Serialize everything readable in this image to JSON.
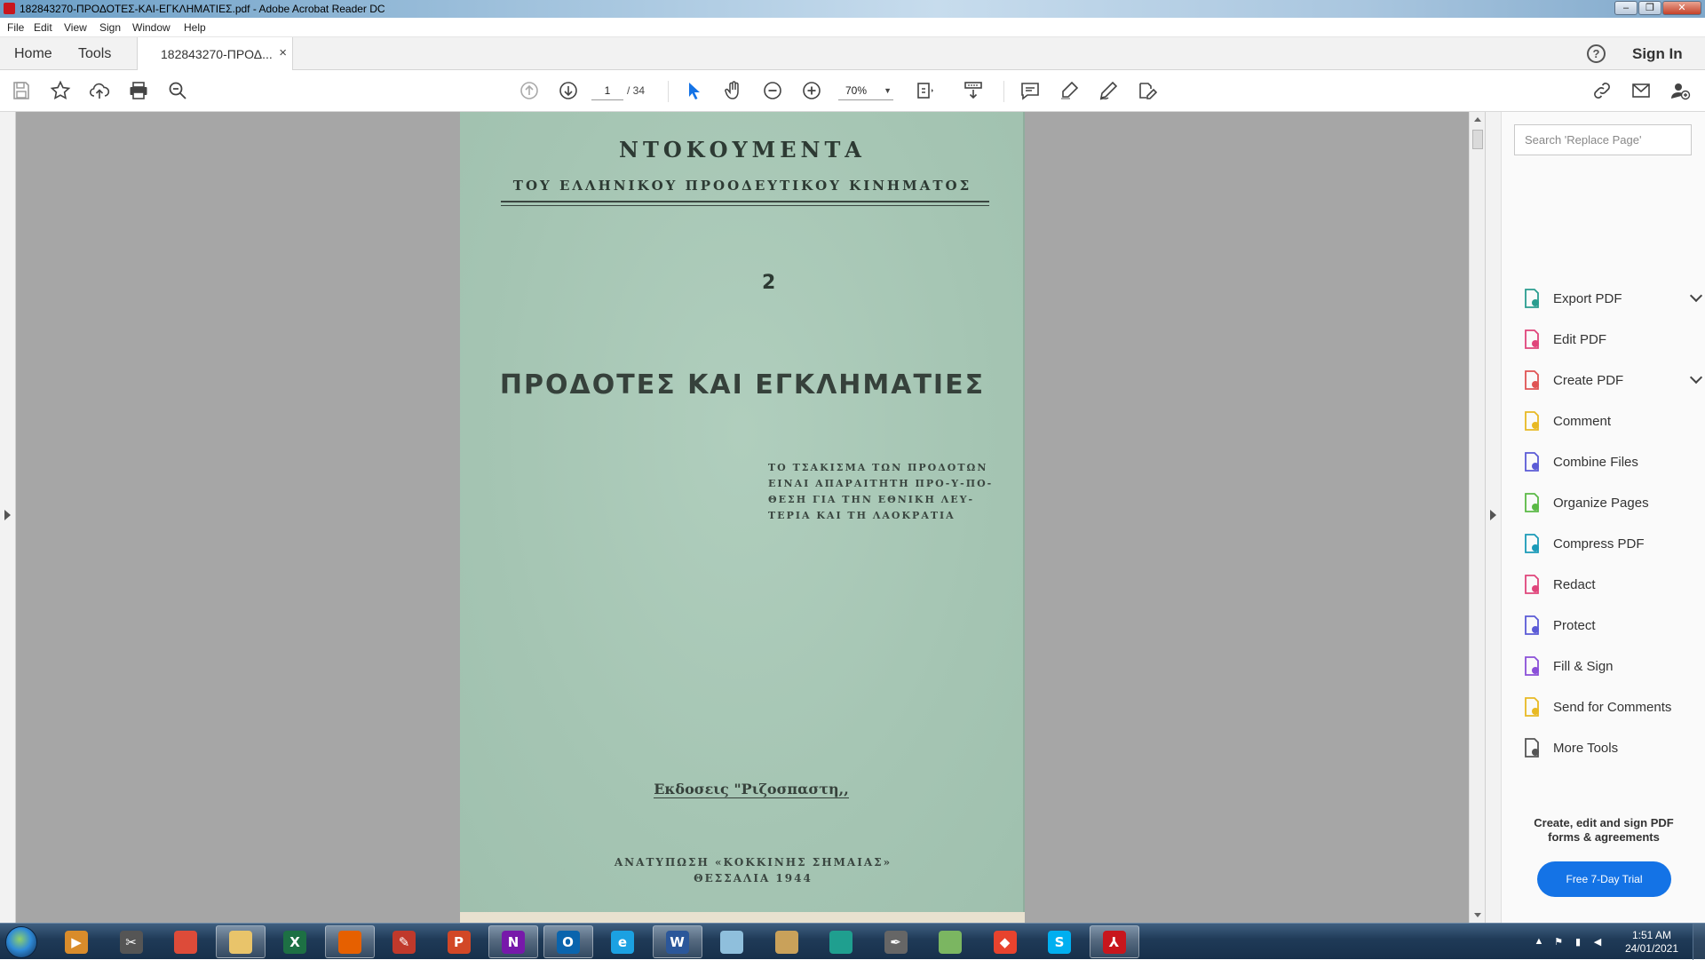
{
  "window": {
    "title": "182843270-ΠΡΟΔΟΤΕΣ-ΚΑΙ-ΕΓΚΛΗΜΑΤΙΕΣ.pdf - Adobe Acrobat Reader DC"
  },
  "menu": [
    "File",
    "Edit",
    "View",
    "Sign",
    "Window",
    "Help"
  ],
  "tabs": {
    "home": "Home",
    "tools": "Tools",
    "document": "182843270-ΠΡΟΔ...",
    "close": "×"
  },
  "header": {
    "help": "?",
    "sign_in": "Sign In"
  },
  "toolbar": {
    "current_page": "1",
    "total_pages": "/ 34",
    "zoom": "70%",
    "icons": [
      "save-icon",
      "bookmark-star-icon",
      "upload-cloud-icon",
      "print-icon",
      "search-zoom-icon",
      "prev-page-icon",
      "next-page-icon",
      "select-cursor-icon",
      "hand-icon",
      "zoom-out-icon",
      "zoom-in-icon",
      "page-fit-icon",
      "scroll-mode-icon",
      "comment-icon",
      "highlight-icon",
      "sign-icon",
      "share-edit-icon",
      "link-icon",
      "email-icon",
      "add-user-icon"
    ]
  },
  "page": {
    "heading": "ΝΤΟΚΟΥΜΕΝΤΑ",
    "subheading": "ΤΟΥ ΕΛΛΗΝΙΚΟΥ ΠΡΟΟΔΕΥΤΙΚΟΥ ΚΙΝΗΜΑΤΟΣ",
    "number": "2",
    "title": "ΠΡΟΔΟΤΕΣ ΚΑΙ ΕΓΚΛΗΜΑΤΙΕΣ",
    "quote": "ΤΟ ΤΣΑΚΙΣΜΑ ΤΩΝ ΠΡΟΔΟΤΩΝ\nΕΙΝΑΙ ΑΠΑΡΑΙΤΗΤΗ ΠΡΟ-Υ-ΠΟ-\nΘΕΣΗ ΓΙΑ ΤΗΝ ΕΘΝΙΚΗ ΛΕΥ-\nΤΕΡΙΑ ΚΑΙ ΤΗ ΛΑΟΚΡΑΤΙΑ",
    "publisher": "Εκδοσεις \"Ριζοσπαστη,,",
    "footer_line1": "ΑΝΑΤΥΠΩΣΗ «ΚΟΚΚΙΝΗΣ ΣΗΜΑΙΑΣ»",
    "footer_line2": "ΘΕΣΣΑΛΙΑ 1944"
  },
  "right_panel": {
    "search_placeholder": "Search 'Replace Page'",
    "tools": [
      {
        "label": "Export PDF",
        "icon": "export-pdf-icon",
        "color": "#2a9d8f",
        "expand": true
      },
      {
        "label": "Edit PDF",
        "icon": "edit-pdf-icon",
        "color": "#e0457b",
        "expand": false
      },
      {
        "label": "Create PDF",
        "icon": "create-pdf-icon",
        "color": "#e05454",
        "expand": true
      },
      {
        "label": "Comment",
        "icon": "comment-icon",
        "color": "#e8b923",
        "expand": false
      },
      {
        "label": "Combine Files",
        "icon": "combine-files-icon",
        "color": "#5b5bd6",
        "expand": false
      },
      {
        "label": "Organize Pages",
        "icon": "organize-pages-icon",
        "color": "#5ab945",
        "expand": false
      },
      {
        "label": "Compress PDF",
        "icon": "compress-pdf-icon",
        "color": "#1a9ab8",
        "expand": false
      },
      {
        "label": "Redact",
        "icon": "redact-icon",
        "color": "#e0457b",
        "expand": false
      },
      {
        "label": "Protect",
        "icon": "protect-shield-icon",
        "color": "#5b5bd6",
        "expand": false
      },
      {
        "label": "Fill & Sign",
        "icon": "fill-sign-icon",
        "color": "#8a4fd8",
        "expand": false
      },
      {
        "label": "Send for Comments",
        "icon": "send-comments-icon",
        "color": "#e8b923",
        "expand": false
      },
      {
        "label": "More Tools",
        "icon": "more-tools-icon",
        "color": "#555555",
        "expand": false
      }
    ],
    "promo": "Create, edit and sign PDF\nforms & agreements",
    "trial_button": "Free 7-Day Trial"
  },
  "taskbar": {
    "apps": [
      {
        "name": "media-player-icon",
        "letter": "▶",
        "color": "#d98c2b"
      },
      {
        "name": "snipping-tool-icon",
        "letter": "✂",
        "color": "#555"
      },
      {
        "name": "chrome-icon",
        "letter": "",
        "color": "#dd4b39"
      },
      {
        "name": "file-explorer-icon",
        "letter": "",
        "color": "#e9c46a"
      },
      {
        "name": "excel-icon",
        "letter": "X",
        "color": "#1d7044"
      },
      {
        "name": "firefox-icon",
        "letter": "",
        "color": "#e66000"
      },
      {
        "name": "paint-brush-icon",
        "letter": "✎",
        "color": "#c0392b"
      },
      {
        "name": "powerpoint-icon",
        "letter": "P",
        "color": "#d24726"
      },
      {
        "name": "onenote-icon",
        "letter": "N",
        "color": "#7719aa"
      },
      {
        "name": "outlook-icon",
        "letter": "O",
        "color": "#0a64ad"
      },
      {
        "name": "internet-explorer-icon",
        "letter": "e",
        "color": "#1ba1e2"
      },
      {
        "name": "word-icon",
        "letter": "W",
        "color": "#2b579a"
      },
      {
        "name": "notepad-icon",
        "letter": "",
        "color": "#8fbfdc"
      },
      {
        "name": "paint-icon",
        "letter": "",
        "color": "#c9a15a"
      },
      {
        "name": "edge-icon",
        "letter": "",
        "color": "#1f9f8f"
      },
      {
        "name": "pen-tool-icon",
        "letter": "✒",
        "color": "#666"
      },
      {
        "name": "chart-app-icon",
        "letter": "",
        "color": "#7bb661"
      },
      {
        "name": "anydesk-icon",
        "letter": "◆",
        "color": "#e8432e"
      },
      {
        "name": "skype-icon",
        "letter": "S",
        "color": "#00aff0"
      },
      {
        "name": "acrobat-icon",
        "letter": "⅄",
        "color": "#c8161d"
      }
    ],
    "time": "1:51 AM",
    "date": "24/01/2021"
  }
}
